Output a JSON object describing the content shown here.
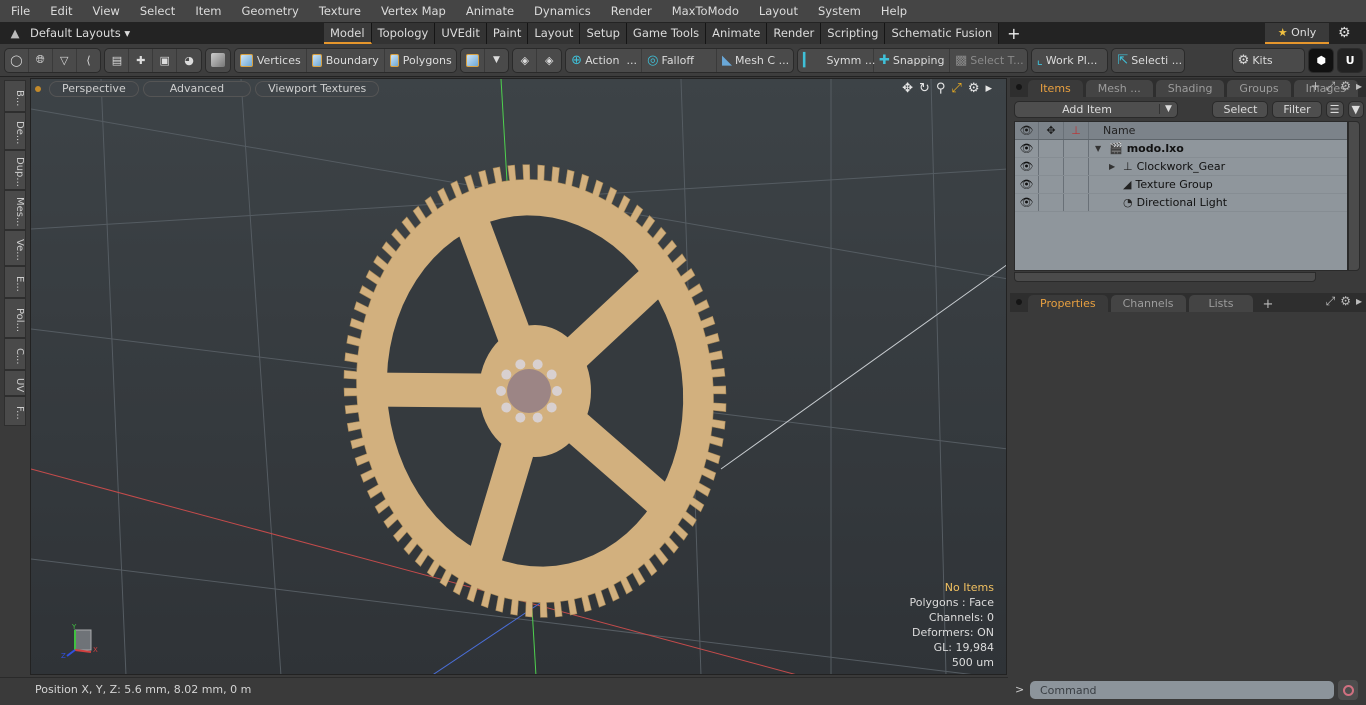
{
  "menubar": {
    "items": [
      "File",
      "Edit",
      "View",
      "Select",
      "Item",
      "Geometry",
      "Texture",
      "Vertex Map",
      "Animate",
      "Dynamics",
      "Render",
      "MaxToModo",
      "Layout",
      "System",
      "Help"
    ]
  },
  "layoutbar": {
    "layouts_label": "Default Layouts ▾",
    "tabs": [
      "Model",
      "Topology",
      "UVEdit",
      "Paint",
      "Layout",
      "Setup",
      "Game Tools",
      "Animate",
      "Render",
      "Scripting",
      "Schematic Fusion"
    ],
    "active_tab": "Model",
    "add_tab": "+",
    "only_label": "Only"
  },
  "toolbar": {
    "vertices": "Vertices",
    "boundary": "Boundary",
    "polygons": "Polygons",
    "action": "Action",
    "action_more": "...",
    "falloff": "Falloff",
    "mesh_c": "Mesh C ...",
    "symm": "Symm ...",
    "snapping": "Snapping",
    "select_t": "Select T...",
    "work_pl": "Work Pl...",
    "selecti": "Selecti ...",
    "kits": "Kits"
  },
  "left_tabs": [
    "B...",
    "De...",
    "Dup...",
    "Mes...",
    "Ve...",
    "E...",
    "Pol...",
    "C...",
    "UV",
    "F..."
  ],
  "viewport": {
    "view_mode": "Perspective",
    "shading": "Advanced",
    "textures": "Viewport Textures",
    "stats": {
      "selection": "No Items",
      "polygons": "Polygons : Face",
      "channels": "Channels: 0",
      "deformers": "Deformers: ON",
      "gl": "GL: 19,984",
      "scale": "500 um"
    },
    "axis_labels": {
      "x": "X",
      "y": "Y",
      "z": "Z"
    }
  },
  "items_panel": {
    "tabs": [
      "Items",
      "Mesh ...",
      "Shading",
      "Groups",
      "Images"
    ],
    "active_tab": "Items",
    "add_item": "Add Item",
    "select": "Select",
    "filter": "Filter",
    "column_name": "Name",
    "tree": [
      {
        "name": "modo.lxo",
        "level": 0,
        "expander": "▼",
        "bold": true,
        "icon": "scene-icon"
      },
      {
        "name": "Clockwork_Gear",
        "level": 1,
        "expander": "▶",
        "bold": false,
        "icon": "mesh-locator-icon"
      },
      {
        "name": "Texture Group",
        "level": 1,
        "expander": "",
        "bold": false,
        "icon": "texture-group-icon"
      },
      {
        "name": "Directional Light",
        "level": 1,
        "expander": "",
        "bold": false,
        "icon": "light-icon"
      }
    ]
  },
  "properties_panel": {
    "tabs": [
      "Properties",
      "Channels",
      "Lists"
    ],
    "active_tab": "Properties"
  },
  "statusbar": {
    "position": "Position X, Y, Z:   5.6 mm, 8.02 mm, 0 m"
  },
  "command": {
    "placeholder": "Command",
    "prompt": ">"
  },
  "colors": {
    "accent": "#e5962c",
    "gear": "#d2b07e",
    "pinion": "#9c8585"
  }
}
